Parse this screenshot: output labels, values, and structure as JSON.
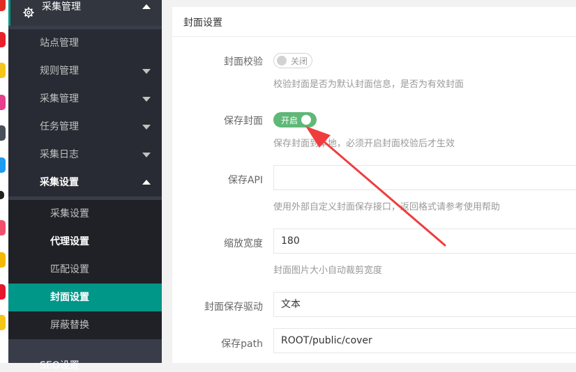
{
  "sidebar": {
    "section_title": "采集管理",
    "items": [
      {
        "label": "站点管理"
      },
      {
        "label": "规则管理"
      },
      {
        "label": "采集管理"
      },
      {
        "label": "任务管理"
      },
      {
        "label": "采集日志"
      },
      {
        "label": "采集设置"
      }
    ],
    "sub_items": [
      {
        "label": "采集设置"
      },
      {
        "label": "代理设置"
      },
      {
        "label": "匹配设置"
      },
      {
        "label": "封面设置"
      },
      {
        "label": "屏蔽替换"
      }
    ],
    "bottom_label": "SEO设置"
  },
  "panel": {
    "title": "封面设置",
    "fields": {
      "check": {
        "label": "封面校验",
        "switch_text": "关闭",
        "hint": "校验封面是否为默认封面信息，是否为有效封面"
      },
      "save": {
        "label": "保存封面",
        "switch_text": "开启",
        "hint": "保存封面到本地，必须开启封面校验后才生效"
      },
      "api": {
        "label": "保存API",
        "value": "",
        "hint": "使用外部自定义封面保存接口，返回格式请参考使用帮助"
      },
      "width": {
        "label": "缩放宽度",
        "value": "180",
        "hint": "封面图片大小自动裁剪宽度"
      },
      "driver": {
        "label": "封面保存驱动",
        "value": "文本"
      },
      "path": {
        "label": "保存path",
        "value": "ROOT/public/cover"
      }
    }
  },
  "colors": {
    "accent": "#009688",
    "switch_on": "#5fb878",
    "annotation_arrow": "#f03c3c",
    "sidebar": "#393d49"
  }
}
